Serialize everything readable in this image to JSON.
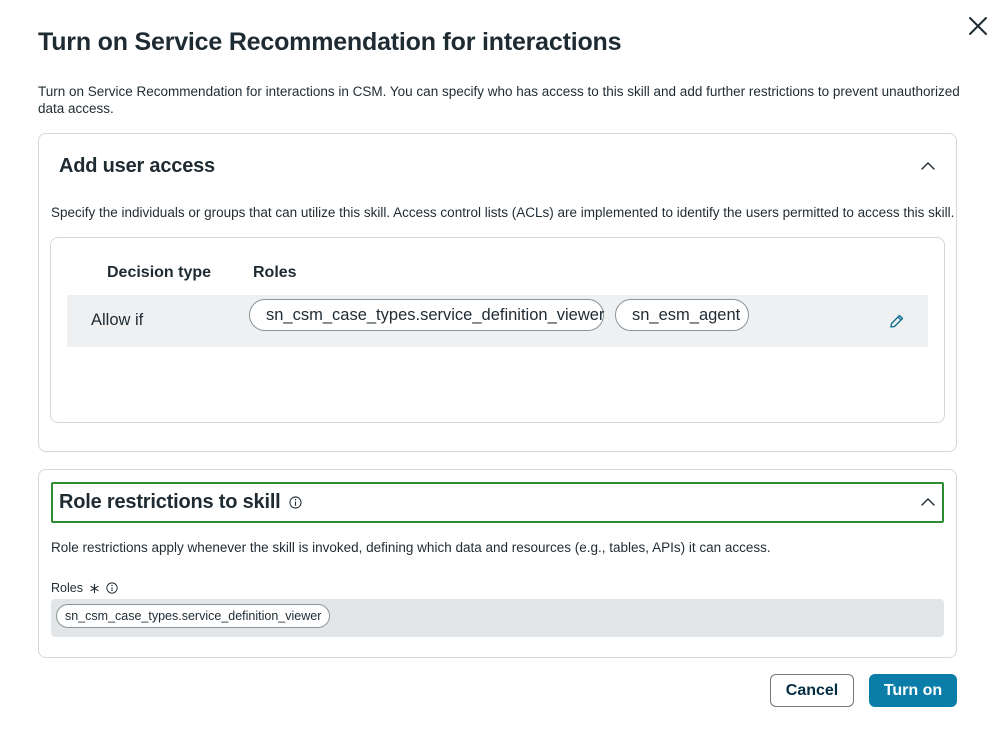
{
  "dialog": {
    "title": "Turn on Service Recommendation for interactions",
    "description": "Turn on Service Recommendation for interactions in CSM. You can specify who has access to this skill and add further restrictions to prevent unauthorized data access.",
    "close_icon": "close-icon"
  },
  "user_access": {
    "title": "Add user access",
    "description": "Specify the individuals or groups that can utilize this skill. Access control lists (ACLs) are implemented to identify the users permitted to access this skill.",
    "columns": {
      "decision_type": "Decision type",
      "roles": "Roles"
    },
    "rule": {
      "decision": "Allow if",
      "roles": [
        "sn_csm_case_types.service_definition_viewer",
        "sn_esm_agent"
      ]
    },
    "expanded": true
  },
  "role_restrictions": {
    "title": "Role restrictions to skill",
    "description": "Role restrictions apply whenever the skill is invoked, defining which data and resources (e.g., tables, APIs) it can access.",
    "field_label": "Roles",
    "roles": [
      "sn_csm_case_types.service_definition_viewer"
    ],
    "expanded": true
  },
  "footer": {
    "cancel_label": "Cancel",
    "primary_label": "Turn on"
  },
  "colors": {
    "primary": "#0a7ea8",
    "focus": "#2e8b32",
    "text": "#1f2b33"
  }
}
